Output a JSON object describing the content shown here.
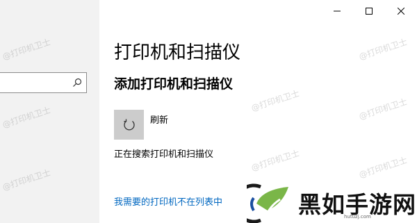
{
  "window": {
    "controls": [
      "minimize",
      "maximize",
      "close"
    ]
  },
  "sidebar": {
    "search": {
      "value": "",
      "icon": "search-icon"
    }
  },
  "main": {
    "title": "打印机和扫描仪",
    "section_title": "添加打印机和扫描仪",
    "refresh": {
      "label": "刷新",
      "icon": "refresh-icon"
    },
    "status_text": "正在搜索打印机和扫描仪",
    "missing_printer_link": "我需要的打印机不在列表中"
  },
  "watermarks": [
    "@打印机卫士",
    "@打印机卫士",
    "@打印机卫士",
    "@打印机卫士",
    "@打印机卫士",
    "@打印机卫士",
    "@打印机卫士",
    "@打印机卫士"
  ],
  "overlay_logo": {
    "text": "黑如手游网",
    "url": "hutuzj.com"
  },
  "colors": {
    "link": "#0067c0",
    "tile": "#cccccc",
    "sidebar": "#f2f2f2"
  }
}
